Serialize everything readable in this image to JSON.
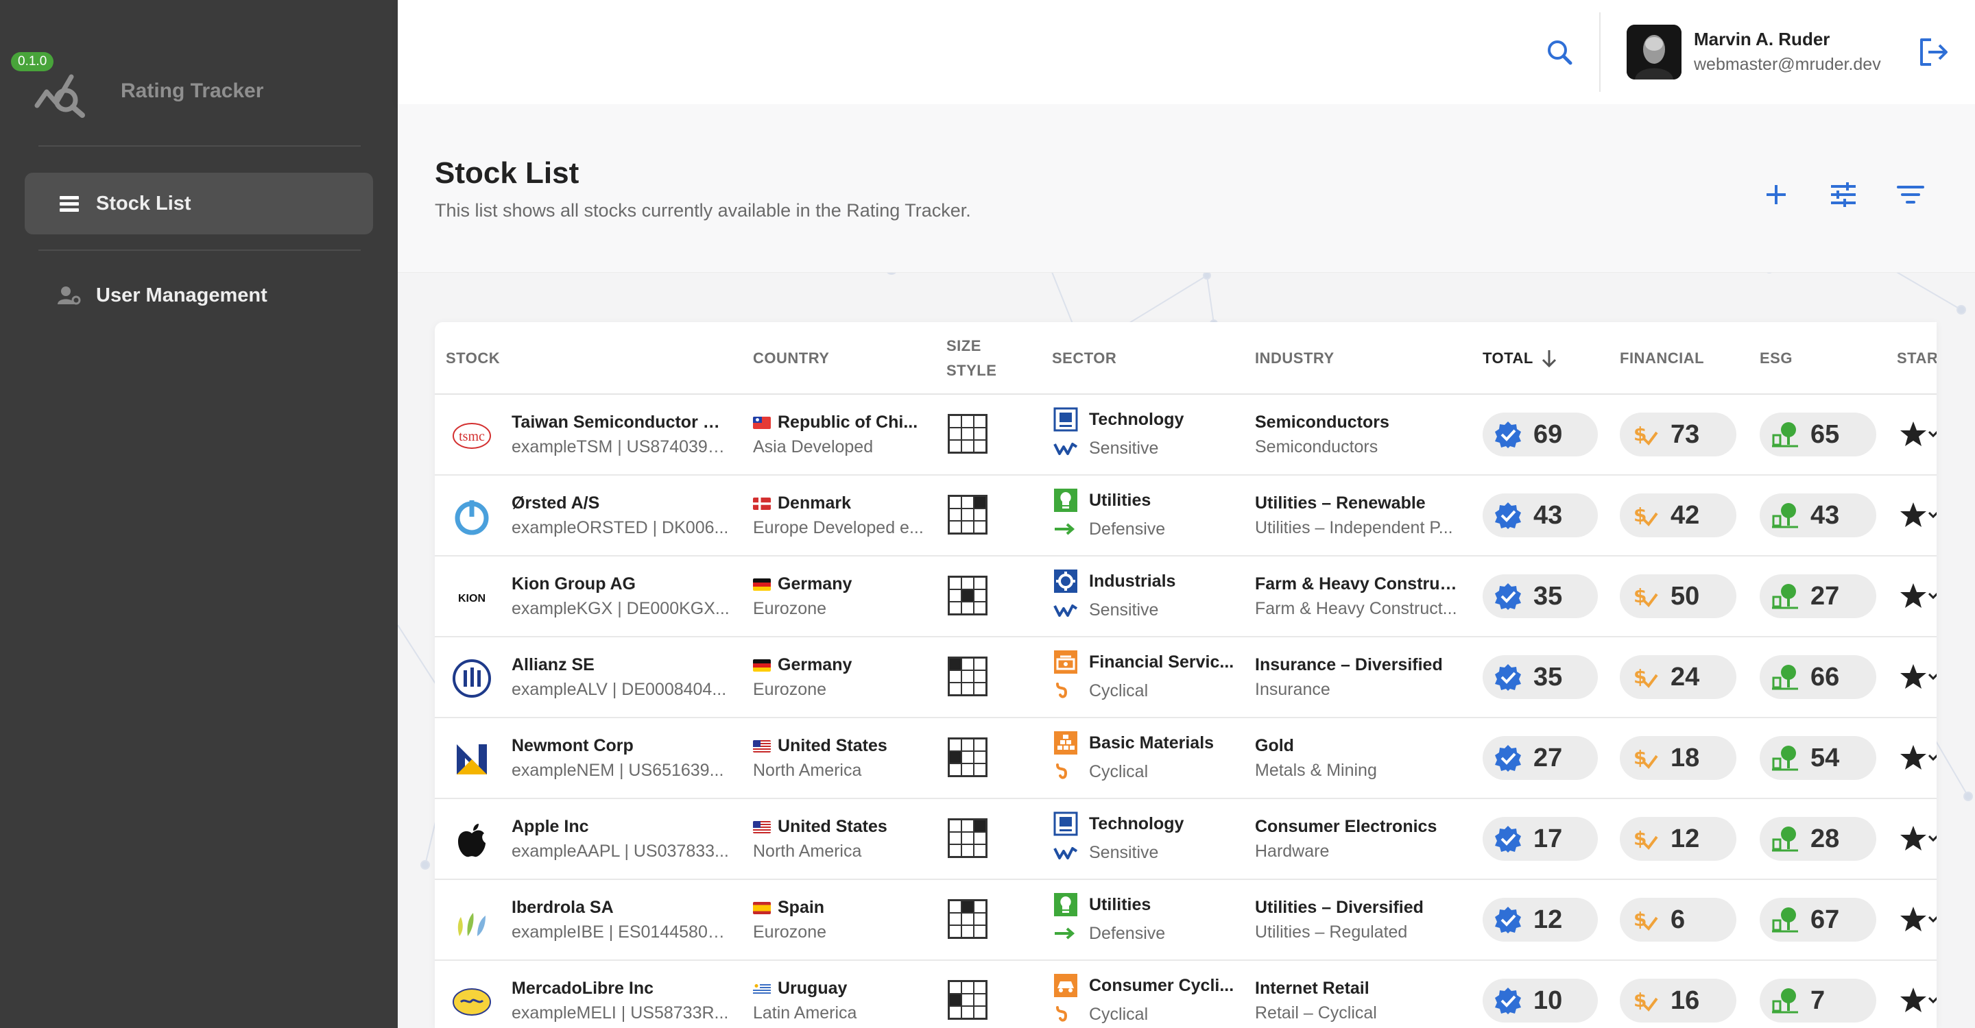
{
  "sidebar": {
    "version": "0.1.0",
    "app_title": "Rating Tracker",
    "items": [
      {
        "label": "Stock List"
      },
      {
        "label": "User Management"
      }
    ]
  },
  "topbar": {
    "user_name": "Marvin A. Ruder",
    "user_email": "webmaster@mruder.dev"
  },
  "page": {
    "title": "Stock List",
    "subtitle": "This list shows all stocks currently available in the Rating Tracker."
  },
  "table": {
    "headers": {
      "stock": "STOCK",
      "country": "COUNTRY",
      "size": "SIZE",
      "style": "STYLE",
      "sector": "SECTOR",
      "industry": "INDUSTRY",
      "total": "TOTAL",
      "financial": "FINANCIAL",
      "esg": "ESG",
      "star": "STAR"
    },
    "rows": [
      {
        "name": "Taiwan Semiconductor M...",
        "ticker": "exampleTSM | US8740391...",
        "flag": "tw",
        "country": "Republic of Chi...",
        "region": "Asia Developed",
        "grid": [
          0,
          0,
          0,
          0,
          0,
          0,
          0,
          0,
          0
        ],
        "sector": "Technology",
        "sector_icon": "technology-icon",
        "cycle": "Sensitive",
        "cycle_icon": "sensitive-icon",
        "industry": "Semiconductors",
        "industry_group": "Semiconductors",
        "total": "69",
        "financial": "73",
        "esg": "65"
      },
      {
        "name": "Ørsted A/S",
        "ticker": "exampleORSTED | DK006...",
        "flag": "dk",
        "country": "Denmark",
        "region": "Europe Developed e...",
        "grid": [
          0,
          0,
          1,
          0,
          0,
          0,
          0,
          0,
          0
        ],
        "sector": "Utilities",
        "sector_icon": "utilities-icon",
        "cycle": "Defensive",
        "cycle_icon": "defensive-icon",
        "industry": "Utilities – Renewable",
        "industry_group": "Utilities – Independent P...",
        "total": "43",
        "financial": "42",
        "esg": "43"
      },
      {
        "name": "Kion Group AG",
        "ticker": "exampleKGX | DE000KGX...",
        "flag": "de",
        "country": "Germany",
        "region": "Eurozone",
        "grid": [
          0,
          0,
          0,
          0,
          1,
          0,
          0,
          0,
          0
        ],
        "sector": "Industrials",
        "sector_icon": "industrials-icon",
        "cycle": "Sensitive",
        "cycle_icon": "sensitive-icon",
        "industry": "Farm & Heavy Construc...",
        "industry_group": "Farm & Heavy Construct...",
        "total": "35",
        "financial": "50",
        "esg": "27"
      },
      {
        "name": "Allianz SE",
        "ticker": "exampleALV | DE0008404...",
        "flag": "de",
        "country": "Germany",
        "region": "Eurozone",
        "grid": [
          1,
          0,
          0,
          0,
          0,
          0,
          0,
          0,
          0
        ],
        "sector": "Financial Servic...",
        "sector_icon": "financial-services-icon",
        "cycle": "Cyclical",
        "cycle_icon": "cyclical-icon",
        "industry": "Insurance – Diversified",
        "industry_group": "Insurance",
        "total": "35",
        "financial": "24",
        "esg": "66"
      },
      {
        "name": "Newmont Corp",
        "ticker": "exampleNEM | US651639...",
        "flag": "us",
        "country": "United States",
        "region": "North America",
        "grid": [
          0,
          0,
          0,
          1,
          0,
          0,
          0,
          0,
          0
        ],
        "sector": "Basic Materials",
        "sector_icon": "basic-materials-icon",
        "cycle": "Cyclical",
        "cycle_icon": "cyclical-icon",
        "industry": "Gold",
        "industry_group": "Metals & Mining",
        "total": "27",
        "financial": "18",
        "esg": "54"
      },
      {
        "name": "Apple Inc",
        "ticker": "exampleAAPL | US037833...",
        "flag": "us",
        "country": "United States",
        "region": "North America",
        "grid": [
          0,
          0,
          1,
          0,
          0,
          0,
          0,
          0,
          0
        ],
        "sector": "Technology",
        "sector_icon": "technology-icon",
        "cycle": "Sensitive",
        "cycle_icon": "sensitive-icon",
        "industry": "Consumer Electronics",
        "industry_group": "Hardware",
        "total": "17",
        "financial": "12",
        "esg": "28"
      },
      {
        "name": "Iberdrola SA",
        "ticker": "exampleIBE | ES0144580Y...",
        "flag": "es",
        "country": "Spain",
        "region": "Eurozone",
        "grid": [
          0,
          1,
          0,
          0,
          0,
          0,
          0,
          0,
          0
        ],
        "sector": "Utilities",
        "sector_icon": "utilities-icon",
        "cycle": "Defensive",
        "cycle_icon": "defensive-icon",
        "industry": "Utilities – Diversified",
        "industry_group": "Utilities – Regulated",
        "total": "12",
        "financial": "6",
        "esg": "67"
      },
      {
        "name": "MercadoLibre Inc",
        "ticker": "exampleMELI | US58733R...",
        "flag": "uy",
        "country": "Uruguay",
        "region": "Latin America",
        "grid": [
          0,
          0,
          0,
          1,
          0,
          0,
          0,
          0,
          0
        ],
        "sector": "Consumer Cycli...",
        "sector_icon": "consumer-cyclical-icon",
        "cycle": "Cyclical",
        "cycle_icon": "cyclical-icon",
        "industry": "Internet Retail",
        "industry_group": "Retail – Cyclical",
        "total": "10",
        "financial": "16",
        "esg": "7"
      }
    ]
  }
}
